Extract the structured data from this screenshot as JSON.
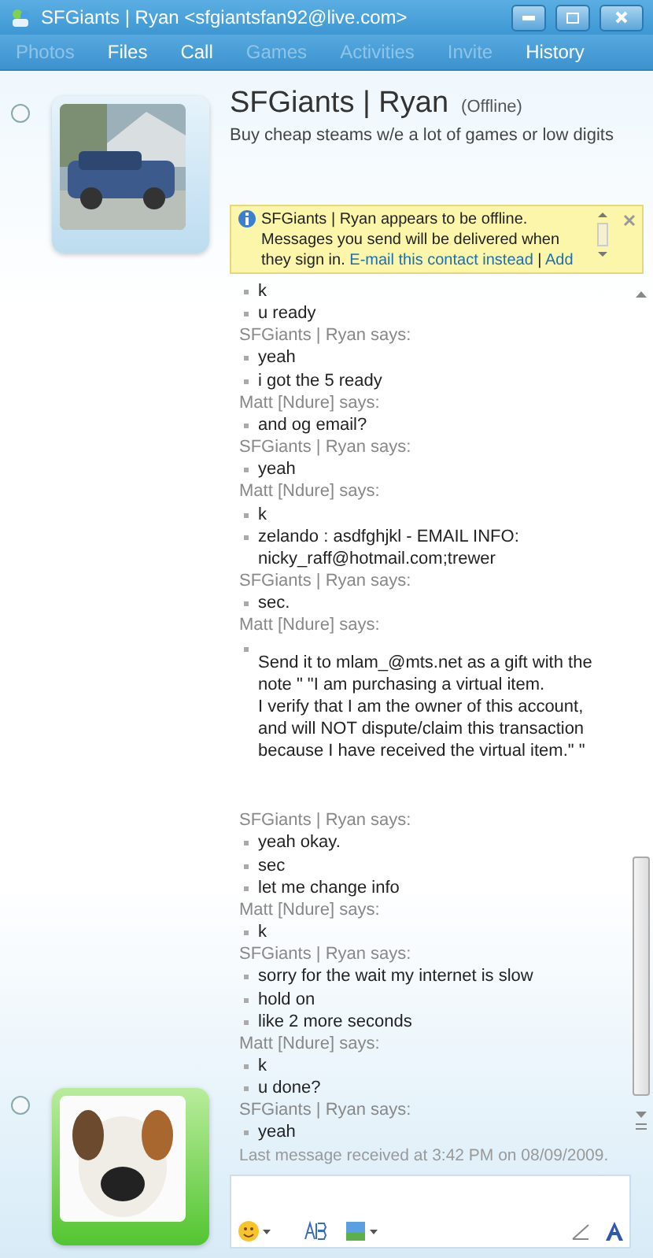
{
  "window": {
    "title": "SFGiants | Ryan <sfgiantsfan92@live.com>"
  },
  "toolbar": {
    "items": [
      {
        "label": "Photos",
        "disabled": true
      },
      {
        "label": "Files",
        "disabled": false
      },
      {
        "label": "Call",
        "disabled": false
      },
      {
        "label": "Games",
        "disabled": true
      },
      {
        "label": "Activities",
        "disabled": true
      },
      {
        "label": "Invite",
        "disabled": true
      },
      {
        "label": "History",
        "disabled": false
      }
    ]
  },
  "contact": {
    "name": "SFGiants | Ryan",
    "status": "(Offline)",
    "message": "Buy cheap steams w/e a lot of games or low digits"
  },
  "notice": {
    "text": "SFGiants | Ryan appears to be offline. Messages you send will be delivered when they sign in.",
    "link": "E-mail this contact instead",
    "separator": "|",
    "link_2": "Add"
  },
  "conversation": [
    {
      "kind": "line",
      "text": "k"
    },
    {
      "kind": "line",
      "text": "u ready"
    },
    {
      "kind": "sender",
      "text": "SFGiants | Ryan says:"
    },
    {
      "kind": "line",
      "text": "yeah"
    },
    {
      "kind": "line",
      "text": "i got the 5 ready"
    },
    {
      "kind": "sender",
      "text": "Matt [Ndure] says:"
    },
    {
      "kind": "line",
      "text": "and og email?"
    },
    {
      "kind": "sender",
      "text": "SFGiants | Ryan says:"
    },
    {
      "kind": "line",
      "text": "yeah"
    },
    {
      "kind": "sender",
      "text": "Matt [Ndure] says:"
    },
    {
      "kind": "line",
      "text": "k"
    },
    {
      "kind": "line",
      "text": "zelando : asdfghjkl - EMAIL INFO: nicky_raff@hotmail.com;trewer"
    },
    {
      "kind": "sender",
      "text": "SFGiants | Ryan says:"
    },
    {
      "kind": "line",
      "text": "sec."
    },
    {
      "kind": "sender",
      "text": "Matt [Ndure] says:"
    },
    {
      "kind": "note",
      "paragraphs": [
        "Send it to mlam_@mts.net as a gift with the note \" \"I am purchasing a virtual item.",
        "I verify that I am the owner of this account, and will NOT dispute/claim this transaction because I have received the virtual item.\" \""
      ]
    },
    {
      "kind": "sender",
      "text": "SFGiants | Ryan says:"
    },
    {
      "kind": "line",
      "text": "yeah okay."
    },
    {
      "kind": "line",
      "text": "sec"
    },
    {
      "kind": "line",
      "text": "let me change info"
    },
    {
      "kind": "sender",
      "text": "Matt [Ndure] says:"
    },
    {
      "kind": "line",
      "text": "k"
    },
    {
      "kind": "sender",
      "text": "SFGiants | Ryan says:"
    },
    {
      "kind": "line",
      "text": "sorry for the wait my internet is slow"
    },
    {
      "kind": "line",
      "text": "hold on"
    },
    {
      "kind": "line",
      "text": "like 2 more seconds"
    },
    {
      "kind": "sender",
      "text": "Matt [Ndure] says:"
    },
    {
      "kind": "line",
      "text": "k"
    },
    {
      "kind": "line",
      "text": "u done?"
    },
    {
      "kind": "sender",
      "text": "SFGiants | Ryan says:"
    },
    {
      "kind": "line",
      "text": "yeah"
    }
  ],
  "footer": "Last message received at 3:42 PM on 08/09/2009."
}
